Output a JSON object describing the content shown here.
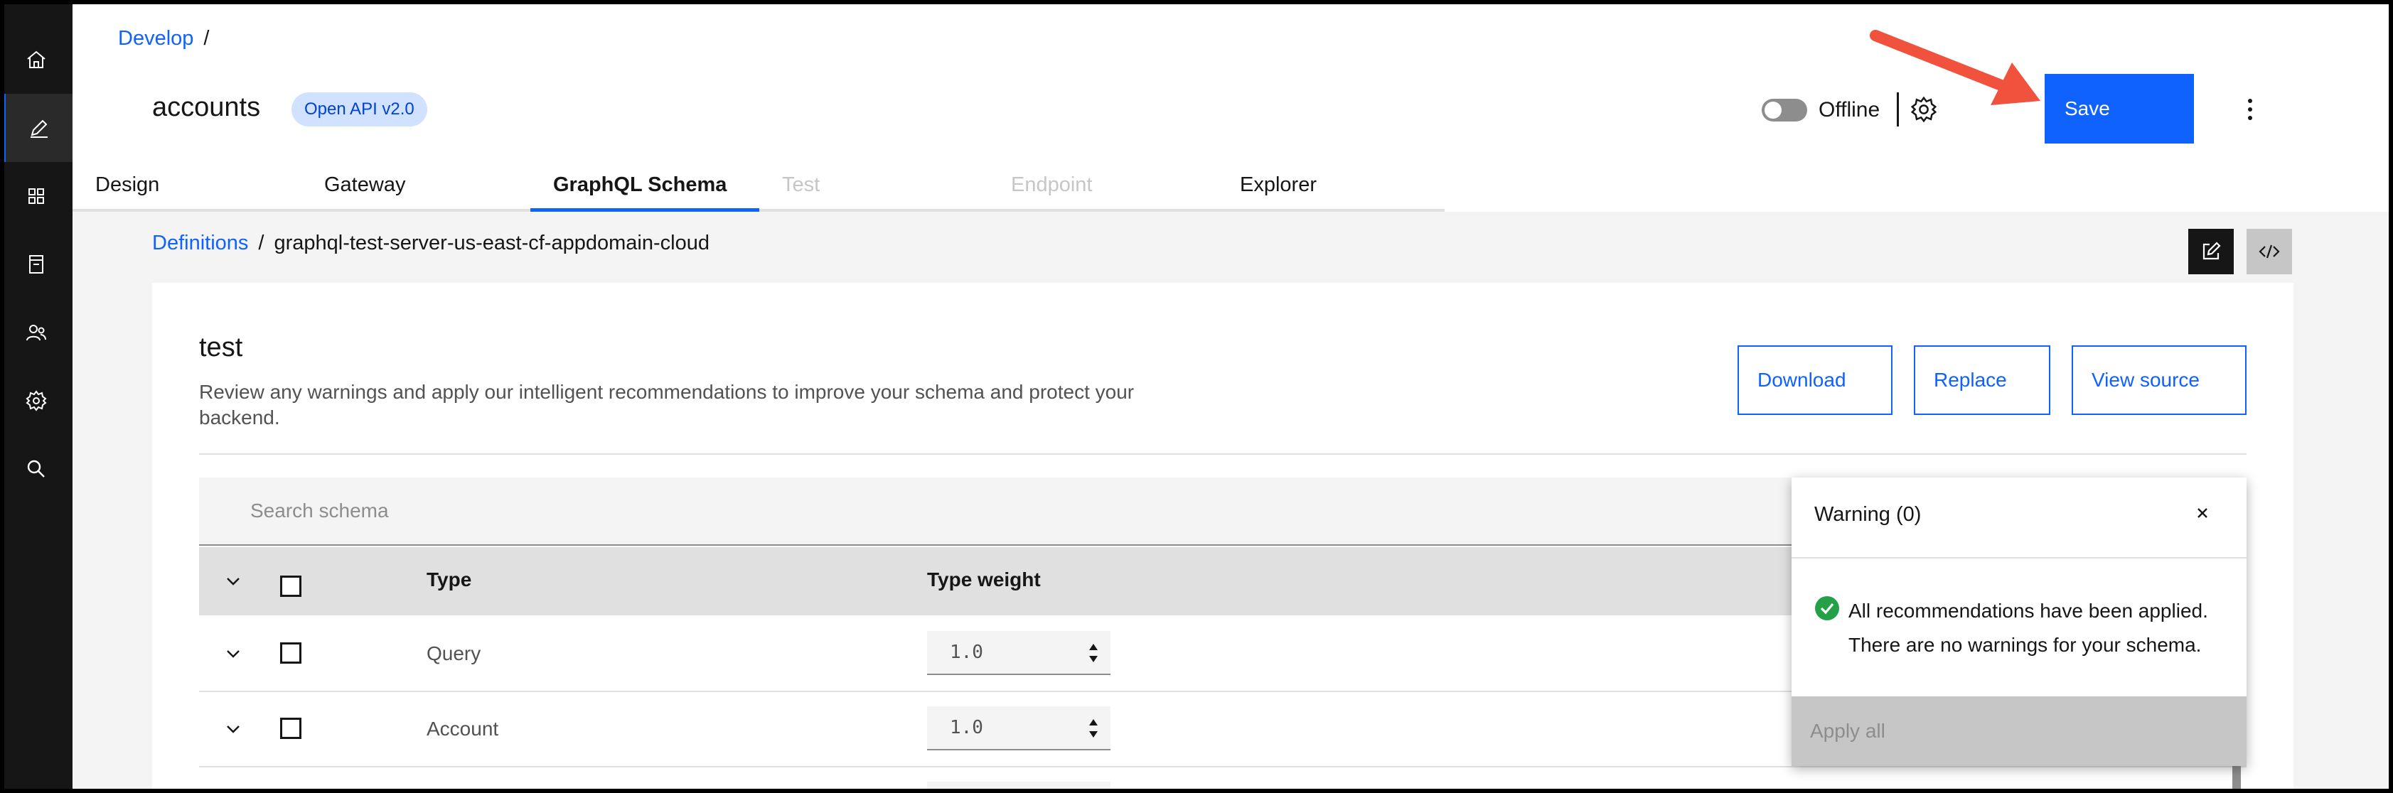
{
  "breadcrumb_top": {
    "root": "Develop",
    "separator": "/"
  },
  "api": {
    "name": "accounts",
    "badge": "Open API v2.0"
  },
  "header": {
    "toggle_label": "Offline",
    "save_label": "Save"
  },
  "tabs": [
    {
      "label": "Design",
      "state": "normal"
    },
    {
      "label": "Gateway",
      "state": "normal"
    },
    {
      "label": "GraphQL Schema",
      "state": "active"
    },
    {
      "label": "Test",
      "state": "disabled"
    },
    {
      "label": "Endpoint",
      "state": "disabled"
    },
    {
      "label": "Explorer",
      "state": "normal"
    }
  ],
  "breadcrumb_sub": {
    "root": "Definitions",
    "separator": "/",
    "current": "graphql-test-server-us-east-cf-appdomain-cloud"
  },
  "schema": {
    "title": "test",
    "description": "Review any warnings and apply our intelligent recommendations to improve your schema and protect your backend.",
    "buttons": {
      "download": "Download",
      "replace": "Replace",
      "view_source": "View source"
    },
    "search_placeholder": "Search schema",
    "columns": {
      "type": "Type",
      "type_weight": "Type weight"
    },
    "rows": [
      {
        "type": "Query",
        "weight": "1.0"
      },
      {
        "type": "Account",
        "weight": "1.0"
      }
    ]
  },
  "warning_panel": {
    "title": "Warning (0)",
    "message_line1": "All recommendations have been applied.",
    "message_line2": "There are no warnings for your schema.",
    "apply_all": "Apply all"
  },
  "colors": {
    "primary": "#0f62fe",
    "nav_bg": "#161616",
    "badge_bg": "#d0e2ff",
    "success": "#24a148",
    "annotation_arrow": "#f0523e"
  },
  "icons": [
    "home-icon",
    "edit-icon",
    "apps-icon",
    "catalog-icon",
    "users-icon",
    "settings-icon",
    "search-icon",
    "gear-icon",
    "overflow-menu-icon",
    "edit-icon",
    "code-icon",
    "chevron-down-icon",
    "close-icon",
    "checkmark-filled-icon",
    "caret-sort-icon"
  ]
}
